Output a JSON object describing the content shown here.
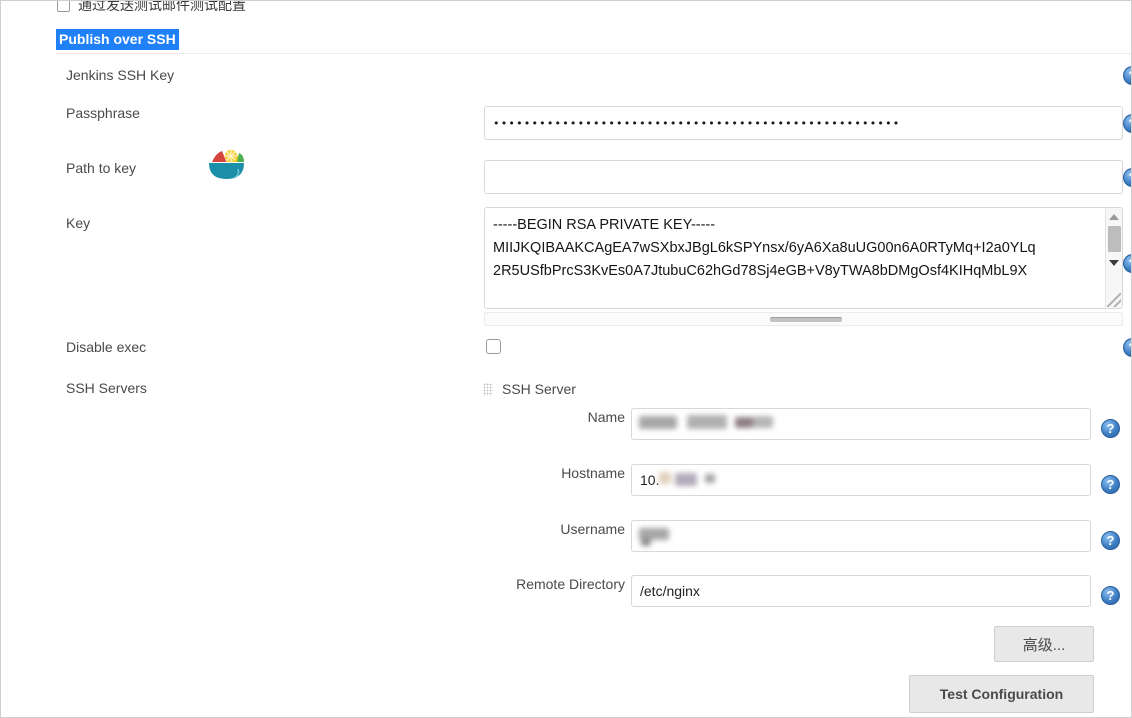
{
  "top_row": {
    "checkbox_label": "通过发送测试邮件测试配置",
    "checked": false
  },
  "section": {
    "title": "Publish over SSH",
    "title_highlight_color": "#2080f7",
    "title_text_color": "#ffffff"
  },
  "fields": {
    "jenkins_ssh_key_label": "Jenkins SSH Key",
    "passphrase_label": "Passphrase",
    "passphrase_value": "•••••••••••••••••••••••••••••••••••••••••••••••••••••",
    "passphrase_masked": true,
    "path_to_key_label": "Path to key",
    "path_to_key_value": "",
    "key_label": "Key",
    "key_value": "-----BEGIN RSA PRIVATE KEY-----\nMIIJKQIBAAKCAgEA7wSXbxJBgL6kSPYnsx/6yA6Xa8uUG00n6A0RTyMq+I2a0YLq\n2R5USfbPrcS3KvEs0A7JtubuC62hGd78Sj4eGB+V8yTWA8bDMgOsf4KIHqMbL9X",
    "disable_exec_label": "Disable exec",
    "disable_exec_checked": false,
    "ssh_servers_label": "SSH Servers"
  },
  "ssh_server": {
    "panel_title": "SSH Server",
    "rows": [
      {
        "label": "Name",
        "value": "",
        "redacted": true
      },
      {
        "label": "Hostname",
        "value": "10.",
        "redacted": true
      },
      {
        "label": "Username",
        "value": "",
        "redacted": true
      },
      {
        "label": "Remote Directory",
        "value": "/etc/nginx",
        "redacted": false
      }
    ]
  },
  "buttons": {
    "advanced": "高级...",
    "test_configuration": "Test Configuration"
  },
  "icons": {
    "help": "?",
    "bowl": "bowl-icon",
    "drag_grip": "drag-grip-icon"
  }
}
